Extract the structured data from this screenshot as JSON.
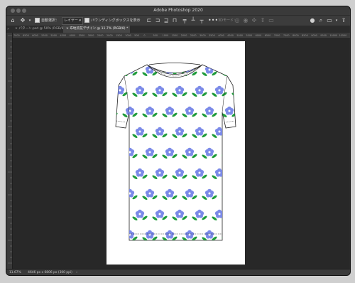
{
  "app": {
    "title": "Adobe Photoshop 2020"
  },
  "options_bar": {
    "auto_select_label": "自動選択：",
    "layer_dropdown_value": "レイヤー",
    "transform_controls_label": "バウンディングボックスを表示",
    "three_d_mode_label": "3Dモード："
  },
  "tabs": [
    {
      "label": "パターン.psd @ 50% (RGB/8) *"
    },
    {
      "label": "布地流花デザイン @ 11.7% (RGB/8) *"
    }
  ],
  "ruler": {
    "ticks": [
      "7000",
      "6500",
      "6000",
      "5500",
      "5000",
      "4500",
      "4000",
      "3500",
      "3000",
      "2500",
      "2000",
      "1500",
      "1000",
      "500",
      "0",
      "500",
      "1000",
      "1500",
      "2000",
      "2500",
      "3000",
      "3500",
      "4000",
      "4500",
      "5000",
      "5500",
      "6000",
      "6500",
      "7000",
      "7500",
      "8000",
      "8500",
      "9000",
      "9500",
      "10000",
      "10500"
    ]
  },
  "status": {
    "zoom": "11.67%",
    "doc_info": "4646 px x 6806 px (300 ppi)"
  },
  "colors": {
    "flower": "#7b8ae8",
    "flower_center": "#ffffff",
    "leaf": "#1f9b3b"
  }
}
